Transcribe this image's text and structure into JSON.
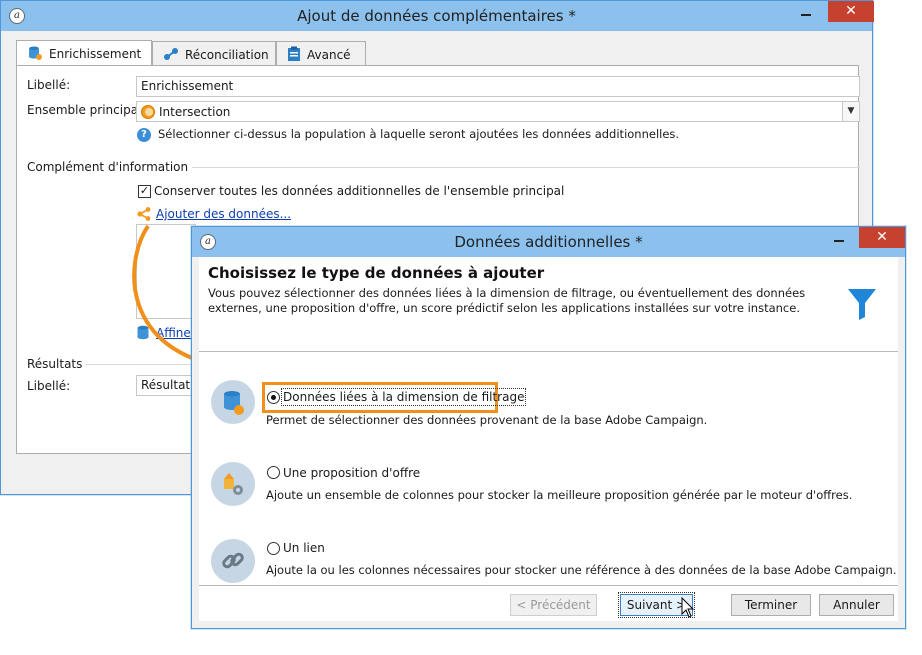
{
  "main_window": {
    "title": "Ajout de données complémentaires *",
    "close_glyph": "✕",
    "tabs": [
      {
        "label": "Enrichissement",
        "icon": "database-gear-icon"
      },
      {
        "label": "Réconciliation",
        "icon": "link-nodes-icon"
      },
      {
        "label": "Avancé",
        "icon": "clipboard-icon"
      }
    ],
    "libelle_label": "Libellé:",
    "libelle_value": "Enrichissement",
    "ensemble_label": "Ensemble principal:",
    "ensemble_value": "Intersection",
    "ensemble_hint": "Sélectionner ci-dessus la population à laquelle seront ajoutées les données additionnelles.",
    "complement_title": "Complément d'information",
    "conserver_label": "Conserver toutes les données additionnelles de l'ensemble principal",
    "conserver_checked": true,
    "add_data_link": "Ajouter des données...",
    "refine_link": "Affiner",
    "results_title": "Résultats",
    "results_libelle_label": "Libellé:",
    "results_libelle_value": "Résultat"
  },
  "dialog": {
    "title": "Données additionnelles *",
    "close_glyph": "✕",
    "heading": "Choisissez le type de données à ajouter",
    "description": "Vous pouvez sélectionner des données liées à la dimension de filtrage, ou éventuellement des données externes, une proposition d'offre, un score prédictif selon les applications installées sur votre instance.",
    "header_icon": "funnel-icon",
    "options": [
      {
        "label": "Données liées à la dimension de filtrage",
        "description": "Permet de sélectionner des données provenant de la base Adobe Campaign.",
        "selected": true,
        "icon": "database-icon"
      },
      {
        "label": "Une proposition d'offre",
        "description": "Ajoute un ensemble de colonnes pour stocker la meilleure proposition générée par le moteur d'offres.",
        "selected": false,
        "icon": "offer-gear-icon"
      },
      {
        "label": "Un lien",
        "description": "Ajoute la ou les colonnes nécessaires pour stocker une référence à des données de la base Adobe Campaign.",
        "selected": false,
        "icon": "link-chain-icon"
      }
    ],
    "buttons": {
      "previous": "< Précédent",
      "next": "Suivant >",
      "finish": "Terminer",
      "cancel": "Annuler"
    }
  },
  "colors": {
    "titlebar": "#8cc1ee",
    "close": "#c7412f",
    "highlight": "#f0901b",
    "link": "#0d3eb3",
    "funnel": "#1f86d8"
  }
}
